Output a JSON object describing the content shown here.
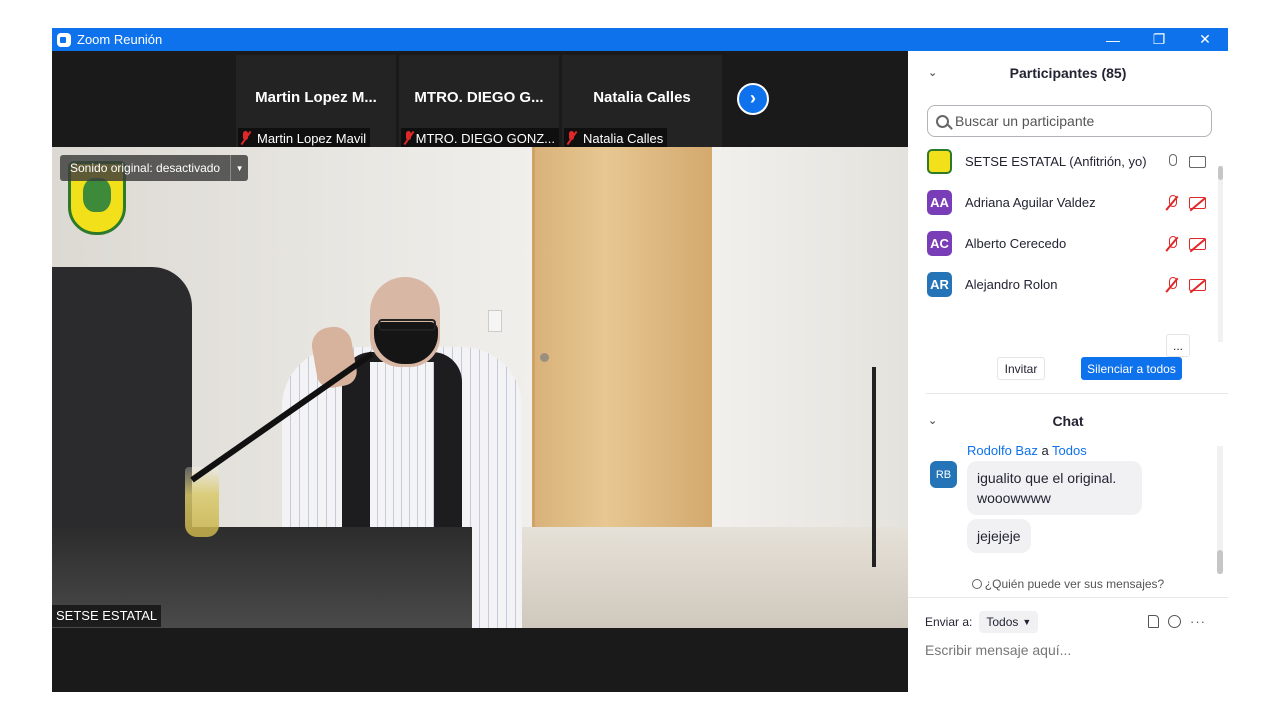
{
  "window": {
    "title": "Zoom Reunión",
    "controls": {
      "minimize": "—",
      "restore": "❐",
      "close": "✕"
    }
  },
  "thumbnails": [
    {
      "display_name": "Martin  Lopez  M...",
      "label": "Martin Lopez Mavil",
      "mic": "muted"
    },
    {
      "display_name": "MTRO. DIEGO G...",
      "label": "MTRO. DIEGO GONZ...",
      "mic": "muted"
    },
    {
      "display_name": "Natalia Calles",
      "label": "Natalia Calles",
      "mic": "muted"
    }
  ],
  "next_button_glyph": "›",
  "main_video": {
    "sound_pill": "Sonido original: desactivado",
    "sound_pill_dropdown": "▼",
    "speaker_label": "SETSE ESTATAL"
  },
  "participants_panel": {
    "title": "Participantes (85)",
    "collapse_glyph": "⌄",
    "search_placeholder": "Buscar un participante",
    "list": [
      {
        "initials": "",
        "name": "SETSE ESTATAL (Anfitrión, yo)",
        "avatar_color": "#f2e01b",
        "mic": "on",
        "cam": "on"
      },
      {
        "initials": "AA",
        "name": "Adriana Aguilar Valdez",
        "avatar_color": "#7a3db8",
        "mic": "muted",
        "cam": "muted"
      },
      {
        "initials": "AC",
        "name": "Alberto Cerecedo",
        "avatar_color": "#7a3db8",
        "mic": "muted",
        "cam": "muted"
      },
      {
        "initials": "AR",
        "name": "Alejandro Rolon",
        "avatar_color": "#2574b8",
        "mic": "muted",
        "cam": "muted"
      }
    ],
    "actions": {
      "invite": "Invitar",
      "mute_all": "Silenciar a todos",
      "more": "..."
    }
  },
  "chat_panel": {
    "title": "Chat",
    "collapse_glyph": "⌄",
    "message_group": {
      "sender": "Rodolfo Baz",
      "connector": " a ",
      "recipient": "Todos",
      "avatar_initials": "RB",
      "messages": [
        "igualito que el original. wooowwww",
        "jejejeje"
      ]
    },
    "who_can_see": "¿Quién puede ver sus mensajes?",
    "send_to_label": "Enviar a:",
    "send_to_value": "Todos",
    "input_placeholder": "Escribir mensaje aquí...",
    "more_glyph": "···"
  },
  "colors": {
    "accent": "#0e72ed",
    "muted_red": "#e02828"
  }
}
